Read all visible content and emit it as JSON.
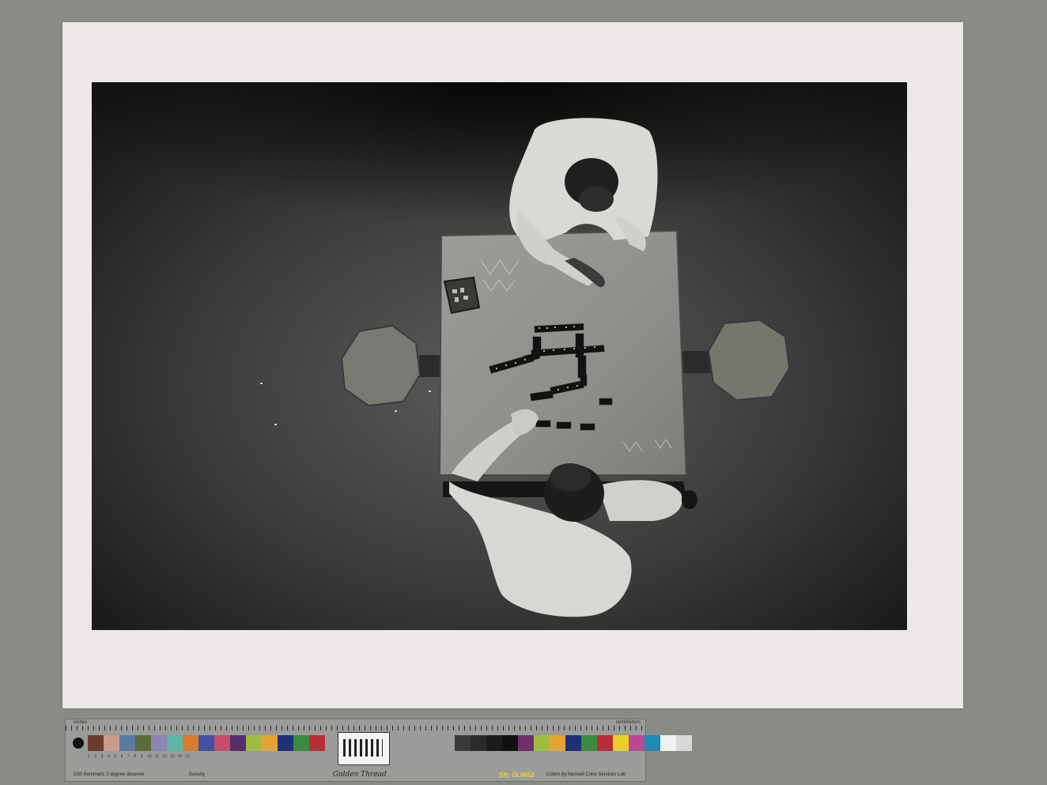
{
  "photo": {
    "subject": "dominoes-game-overhead"
  },
  "color_target": {
    "ruler_left": "inches",
    "ruler_right": "centimeters",
    "illuminant": "D50 illuminant, 2 degree observer",
    "density_label": "Density",
    "brand": "Golden Thread",
    "serial": "SN: OL0052",
    "credit": "Colors by Munsell Color Services Lab",
    "swatch_colors": [
      "#6a3b2e",
      "#c99a8e",
      "#5b7aa2",
      "#5a6b39",
      "#8b86b4",
      "#5fb3a7",
      "#d97b2e",
      "#3f52a3",
      "#c44e68",
      "#53306a",
      "#9fbd45",
      "#e2a437",
      "#1f2f7a",
      "#3b8a41",
      "#b72e36",
      "#e9cf2a",
      "#b94993",
      "#1f8bb5",
      "#f1f1f1",
      "#d8d8d8",
      "#bdbdbd",
      "#a3a3a3",
      "#8a8a8a",
      "#717171"
    ],
    "gray_colors": [
      "#3a3a3a",
      "#2a2a2a",
      "#1c1c1c",
      "#111111",
      "#6f2f6a",
      "#9fbd45",
      "#e2a437",
      "#1f2f7a",
      "#3b8a41",
      "#b72e36",
      "#e9cf2a",
      "#b94993",
      "#1f8bb5",
      "#f1f1f1",
      "#d8d8d8"
    ]
  }
}
